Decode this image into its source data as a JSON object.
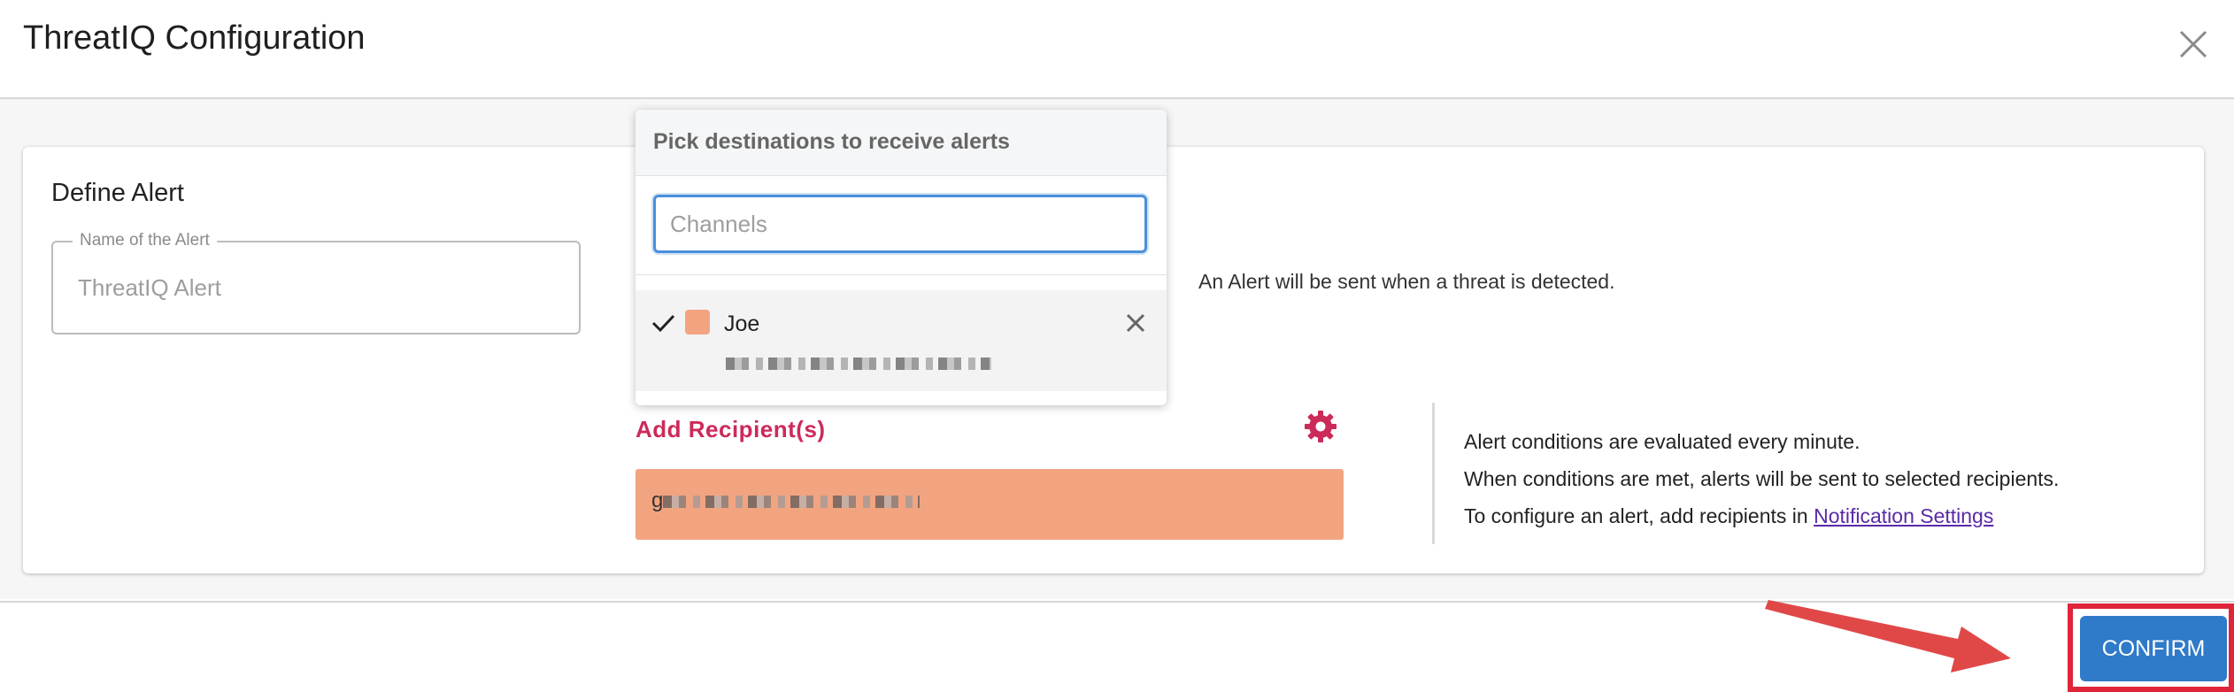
{
  "dialog": {
    "title": "ThreatIQ Configuration",
    "close_icon": "close-icon"
  },
  "define_alert": {
    "section_title": "Define Alert",
    "name_field": {
      "legend": "Name of the Alert",
      "placeholder": "ThreatIQ Alert",
      "value": ""
    },
    "note": "An Alert will be sent when a threat is detected."
  },
  "recipients": {
    "add_label": "Add Recipient(s)",
    "settings_icon": "gear-icon",
    "chip_prefix": "g",
    "chip_color": "#f2a481"
  },
  "info": {
    "line1": "Alert conditions are evaluated every minute.",
    "line2": "When conditions are met, alerts will be sent to selected recipients.",
    "line3": "To configure an alert, add recipients in",
    "link": "Notification Settings"
  },
  "dropdown": {
    "title": "Pick destinations to receive alerts",
    "search_placeholder": "Channels",
    "items": [
      {
        "name": "Joe",
        "selected": true,
        "color": "#f2a481"
      }
    ]
  },
  "footer": {
    "confirm_label": "CONFIRM",
    "accent": "#2f7ac9",
    "highlight": "#e0243a"
  }
}
